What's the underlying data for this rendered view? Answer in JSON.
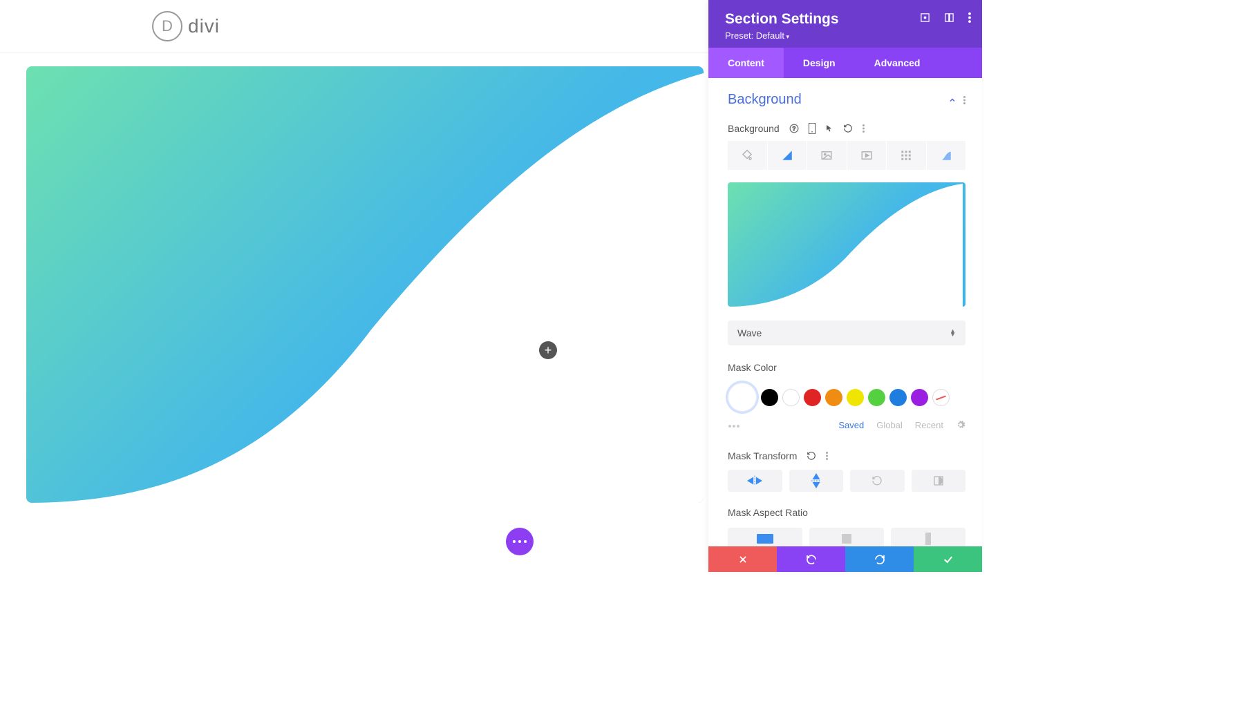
{
  "brand": {
    "glyph": "D",
    "name": "divi"
  },
  "panel": {
    "title": "Section Settings",
    "preset_label": "Preset: Default",
    "tabs": [
      "Content",
      "Design",
      "Advanced"
    ],
    "active_tab": 0
  },
  "accordion": {
    "title": "Background"
  },
  "background_field_label": "Background",
  "bg_type_icons": [
    "color",
    "gradient",
    "image",
    "video",
    "pattern",
    "mask"
  ],
  "bg_type_active": 1,
  "mask_style": {
    "selected": "Wave"
  },
  "mask_color": {
    "label": "Mask Color",
    "colors": [
      "#000000",
      "#ffffff",
      "#e02424",
      "#ef8d12",
      "#f0e500",
      "#55d040",
      "#1f7de0",
      "#9b1fe0"
    ],
    "palette_links": [
      "Saved",
      "Global",
      "Recent"
    ],
    "palette_active": "Saved"
  },
  "mask_transform": {
    "label": "Mask Transform"
  },
  "mask_aspect": {
    "label": "Mask Aspect Ratio"
  },
  "chart_data": null
}
